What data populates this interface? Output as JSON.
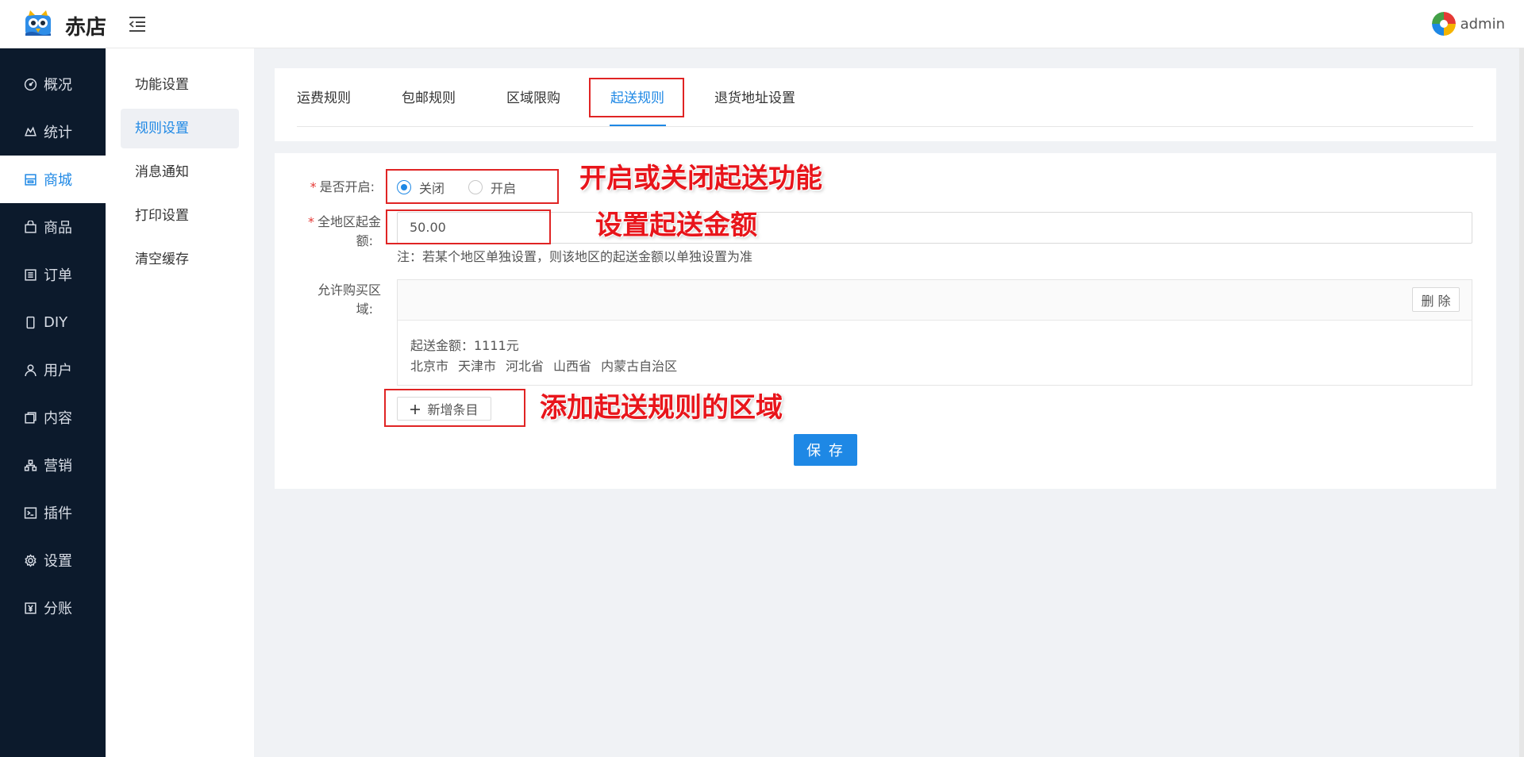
{
  "brand": {
    "name": "赤店"
  },
  "user": {
    "name": "admin"
  },
  "sidebar": {
    "items": [
      {
        "label": "概况",
        "icon": "dashboard-icon"
      },
      {
        "label": "统计",
        "icon": "chart-icon"
      },
      {
        "label": "商城",
        "icon": "store-icon",
        "active": true
      },
      {
        "label": "商品",
        "icon": "bag-icon"
      },
      {
        "label": "订单",
        "icon": "list-icon"
      },
      {
        "label": "DIY",
        "icon": "phone-icon"
      },
      {
        "label": "用户",
        "icon": "user-icon"
      },
      {
        "label": "内容",
        "icon": "copy-icon"
      },
      {
        "label": "营销",
        "icon": "network-icon"
      },
      {
        "label": "插件",
        "icon": "terminal-icon"
      },
      {
        "label": "设置",
        "icon": "gear-icon"
      },
      {
        "label": "分账",
        "icon": "yen-icon"
      }
    ]
  },
  "subnav": {
    "items": [
      {
        "label": "功能设置"
      },
      {
        "label": "规则设置",
        "active": true
      },
      {
        "label": "消息通知"
      },
      {
        "label": "打印设置"
      },
      {
        "label": "清空缓存"
      }
    ]
  },
  "tabs": [
    {
      "label": "运费规则"
    },
    {
      "label": "包邮规则"
    },
    {
      "label": "区域限购"
    },
    {
      "label": "起送规则",
      "active": true
    },
    {
      "label": "退货地址设置"
    }
  ],
  "form": {
    "enable_label": "是否开启:",
    "required_mark": "*",
    "radio_off": "关闭",
    "radio_on": "开启",
    "selected": "关闭",
    "amount_label_line1": "全地区起金",
    "amount_label_line2": "额:",
    "amount_value": "50.00",
    "note": "注：若某个地区单独设置，则该地区的起送金额以单独设置为准",
    "region_label_line1": "允许购买区",
    "region_label_line2": "域:",
    "delete_label": "删 除",
    "region_amount": "起送金额：1111元",
    "regions": [
      "北京市",
      "天津市",
      "河北省",
      "山西省",
      "内蒙古自治区"
    ],
    "add_label": "新增条目",
    "save_label": "保 存"
  },
  "annotations": {
    "toggle": "开启或关闭起送功能",
    "amount": "设置起送金额",
    "add": "添加起送规则的区域"
  },
  "colors": {
    "sidebar_bg": "#0c1a2c",
    "accent": "#1e88e5",
    "annotation": "#e8151b"
  }
}
